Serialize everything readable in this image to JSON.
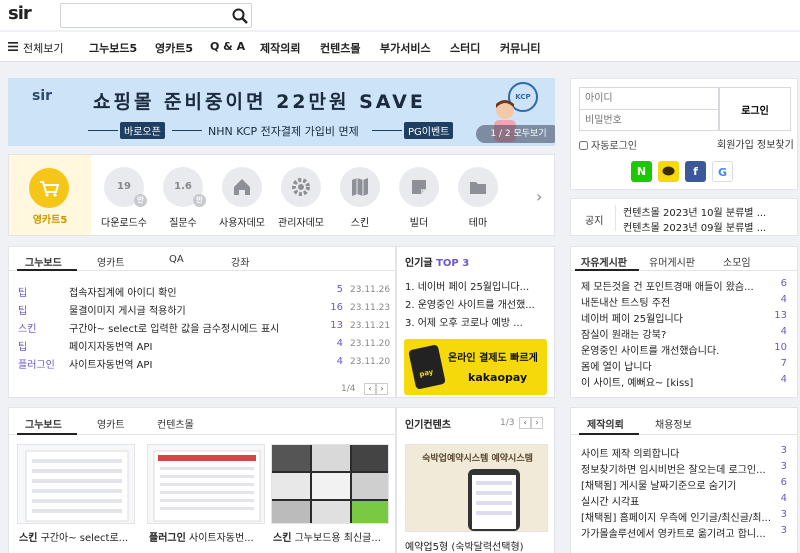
{
  "header": {
    "logo": "sir",
    "search_placeholder": ""
  },
  "nav": {
    "all": "전체보기",
    "items": [
      "그누보드5",
      "영카트5",
      "Q & A",
      "제작의뢰",
      "컨텐츠몰",
      "부가서비스",
      "스터디",
      "커뮤니티"
    ]
  },
  "banner": {
    "logo": "sir",
    "title": "쇼핑몰 준비중이면 22만원 SAVE",
    "pill_left": "바로오픈",
    "subtitle": "NHN KCP 전자결제 가입비 면제",
    "pill_right": "PG이벤트",
    "pager": "1 / 2  모두보기",
    "kcp": "KCP"
  },
  "login": {
    "id_placeholder": "아이디",
    "pw_placeholder": "비밀번호",
    "button": "로그인",
    "auto_login": "자동로그인",
    "signup": "회원가입",
    "find": "정보찾기",
    "sns": [
      {
        "label": "N",
        "color": "#1ec800"
      },
      {
        "label": "💬",
        "color": "#f5d90a"
      },
      {
        "label": "f",
        "color": "#3b5998"
      },
      {
        "label": "G",
        "color": "#ffffff"
      }
    ]
  },
  "shortcuts": {
    "main_label": "영카트5",
    "items": [
      {
        "icon": "download-count-icon",
        "value": "19",
        "badge": "만",
        "label": "다운로드수"
      },
      {
        "icon": "question-count-icon",
        "value": "1.6",
        "badge": "만",
        "label": "질문수"
      },
      {
        "icon": "home-icon",
        "value": "",
        "badge": "",
        "label": "사용자데모"
      },
      {
        "icon": "gear-icon",
        "value": "",
        "badge": "",
        "label": "관리자데모"
      },
      {
        "icon": "map-icon",
        "value": "",
        "badge": "",
        "label": "스킨"
      },
      {
        "icon": "note-icon",
        "value": "",
        "badge": "",
        "label": "빌더"
      },
      {
        "icon": "folder-icon",
        "value": "",
        "badge": "",
        "label": "테마"
      }
    ]
  },
  "notice": {
    "label": "공지",
    "items": [
      "컨텐츠몰 2023년 10월 분류별 ...",
      "컨텐츠몰 2023년 09월 분류별 ..."
    ]
  },
  "board1": {
    "tabs": [
      "그누보드",
      "영카트",
      "QA",
      "강좌"
    ],
    "rows": [
      {
        "cat": "팁",
        "title": "접속자집계에 아이디 확인",
        "count": "5",
        "date": "23.11.26"
      },
      {
        "cat": "팁",
        "title": "물결이미지 게시글 적용하기",
        "count": "16",
        "date": "23.11.23"
      },
      {
        "cat": "스킨",
        "title": "구간아~ select로 입력한 값을 금수정시에드 표시",
        "count": "13",
        "date": "23.11.21"
      },
      {
        "cat": "팁",
        "title": "페이지자동번역 API",
        "count": "4",
        "date": "23.11.20"
      },
      {
        "cat": "플러그인",
        "title": "사이트자동번역 API",
        "count": "4",
        "date": "23.11.20"
      }
    ],
    "pager": "1/4"
  },
  "popular": {
    "title": "인기글",
    "top": "TOP 3",
    "items": [
      "1. 네이버 페이 25월입니다...",
      "2. 운영중인 사이트를 개선했...",
      "3. 어제 오후 코로나 예방 ..."
    ],
    "ad_cta": "온라인 결제도 빠르게",
    "ad_brand": "kakaopay",
    "ad_card": "pay"
  },
  "community": {
    "tabs": [
      "자유게시판",
      "유머게시판",
      "소모임"
    ],
    "rows": [
      {
        "title": "제 모든것을 건 포인트경매 애들이 왔슴...",
        "count": "6"
      },
      {
        "title": "내돈내산 트스팅 주전",
        "count": "4"
      },
      {
        "title": "네이버 페이 25월입니다",
        "count": "13"
      },
      {
        "title": "잠실이 원래는 강북?",
        "count": "4"
      },
      {
        "title": "운영중인 사이트를 개선했습니다.",
        "count": "10"
      },
      {
        "title": "몸에 열이 납니다",
        "count": "7"
      },
      {
        "title": "이 사이트, 예뻐요~ [kiss]",
        "count": "4"
      }
    ]
  },
  "gallery": {
    "tabs": [
      "그누보드",
      "영카트",
      "컨텐츠몰"
    ],
    "items": [
      {
        "cat": "스킨",
        "title": "구간아~ select로..."
      },
      {
        "cat": "플러그인",
        "title": "사이트자동번..."
      },
      {
        "cat": "스킨",
        "title": "그누보드용 최신글..."
      }
    ]
  },
  "content_pick": {
    "title": "인기컨텐츠",
    "pager": "1/3",
    "thumb_title": "숙박업예약시스템 예약시스템",
    "caption": "예약업5형 (숙박달력선택형)"
  },
  "request": {
    "tabs": [
      "제작의뢰",
      "채용정보"
    ],
    "rows": [
      {
        "title": "사이트 제작 의뢰합니다",
        "count": "3"
      },
      {
        "title": "정보찾기하면 임시비번은 잘오는데 로그인...",
        "count": "3"
      },
      {
        "title": "[채택됨] 게시물 날짜기준으로 숨기기",
        "count": "6"
      },
      {
        "title": "실시간 시각표",
        "count": "4"
      },
      {
        "title": "[채택됨] 홈페이지 우측에 인기글/최신글/최...",
        "count": "3"
      },
      {
        "title": "가가몰솔루션에서 영카트로 옮기려고 합니...",
        "count": "3"
      }
    ]
  }
}
